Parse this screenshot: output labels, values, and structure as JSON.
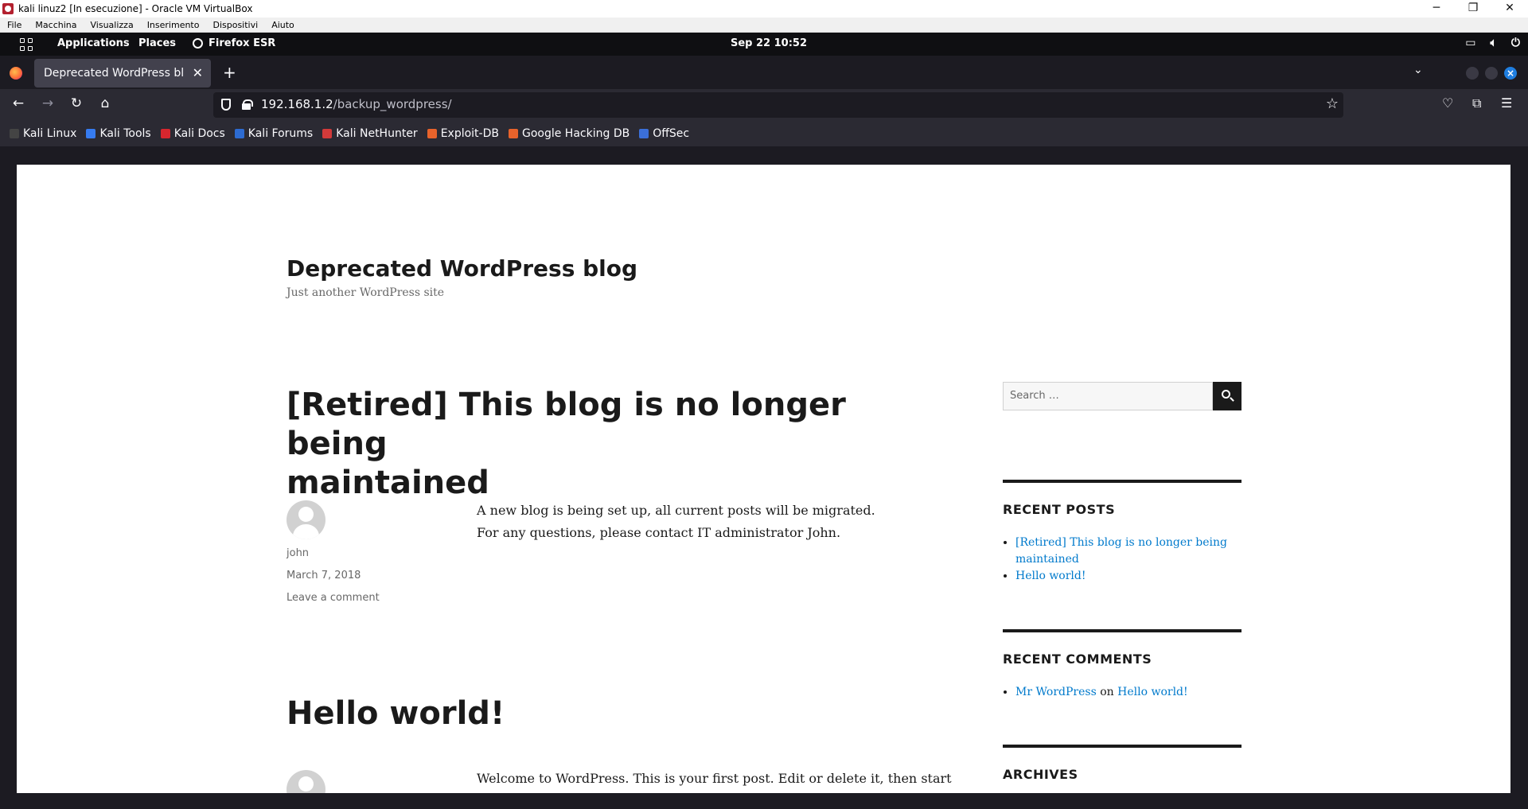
{
  "vbox": {
    "title": "kali linuz2 [In esecuzione] - Oracle VM VirtualBox",
    "menu": [
      "File",
      "Macchina",
      "Visualizza",
      "Inserimento",
      "Dispositivi",
      "Aiuto"
    ]
  },
  "panel": {
    "applications": "Applications",
    "places": "Places",
    "active_app": "Firefox ESR",
    "clock": "Sep 22  10:52"
  },
  "browser": {
    "tab_title": "Deprecated WordPress blog",
    "url_host": "192.168.1.2",
    "url_path": "/backup_wordpress/",
    "bookmarks": [
      "Kali Linux",
      "Kali Tools",
      "Kali Docs",
      "Kali Forums",
      "Kali NetHunter",
      "Exploit-DB",
      "Google Hacking DB",
      "OffSec"
    ]
  },
  "site": {
    "title": "Deprecated WordPress blog",
    "description": "Just another WordPress site"
  },
  "posts": [
    {
      "title_line1": "[Retired] This blog is no longer being",
      "title_line2": "maintained",
      "author": "john",
      "date": "March 7, 2018",
      "comments": "Leave a comment",
      "content_line1": "A new blog is being set up, all current posts will be migrated.",
      "content_line2": "For any questions, please contact IT administrator John."
    },
    {
      "title": "Hello world!",
      "content_line1": "Welcome to WordPress. This is your first post. Edit or delete it, then start"
    }
  ],
  "sidebar": {
    "search_placeholder": "Search …",
    "recent_posts_title": "RECENT POSTS",
    "recent_posts": [
      {
        "line1": "[Retired] This blog is no longer being",
        "line2": "maintained"
      },
      {
        "line1": "Hello world!"
      }
    ],
    "recent_comments_title": "RECENT COMMENTS",
    "comment_author": "Mr WordPress",
    "comment_on": "on",
    "comment_post": "Hello world!",
    "archives_title": "ARCHIVES"
  },
  "colors": {
    "link": "#007acc",
    "text": "#1a1a1a",
    "browser_dark": "#2b2a33"
  }
}
